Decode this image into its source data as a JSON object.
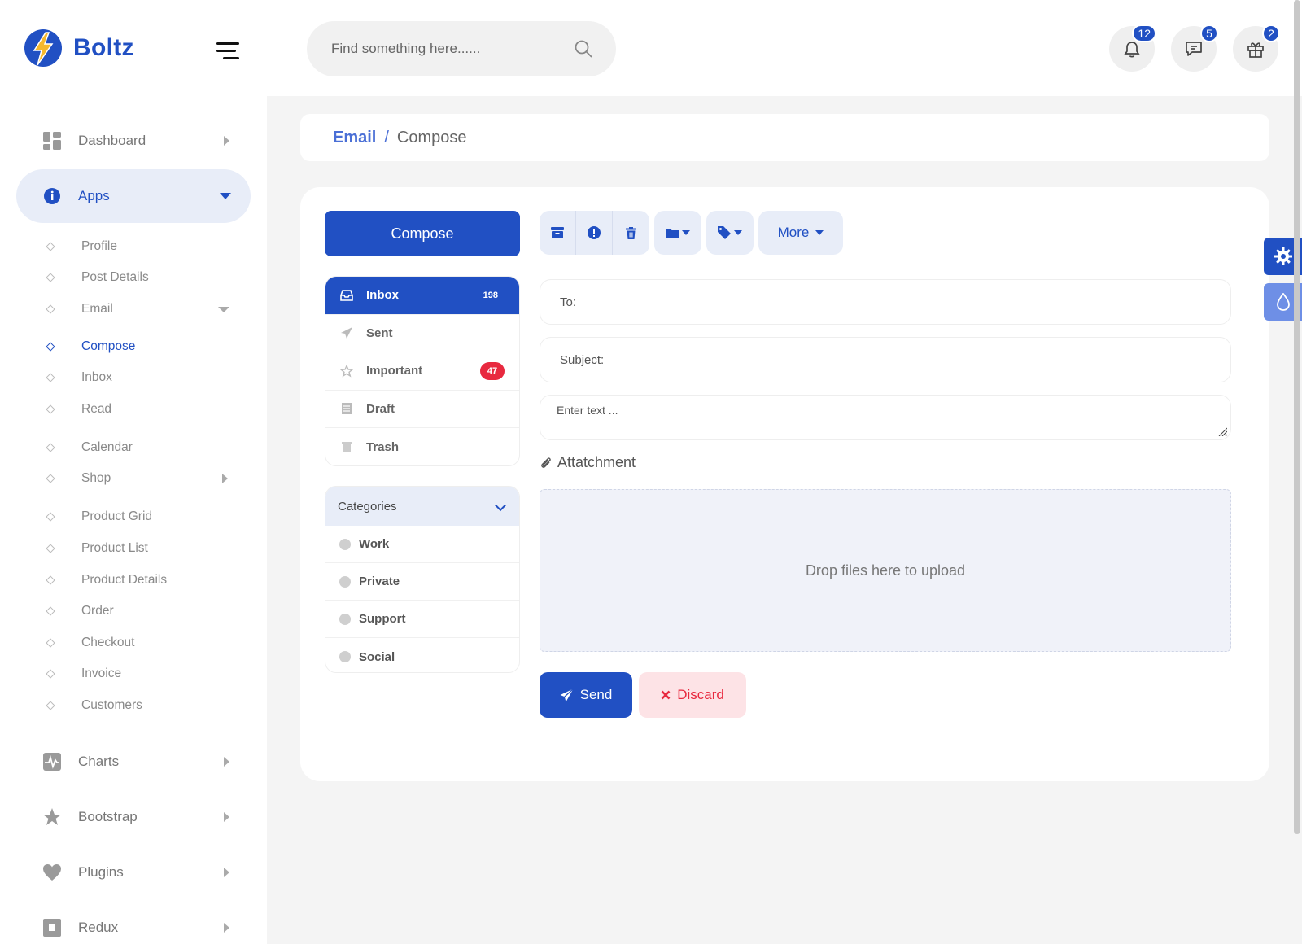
{
  "brand": {
    "name": "Boltz",
    "accent": "#2150c3"
  },
  "header": {
    "search_placeholder": "Find something here......",
    "notifications": {
      "icon": "bell-icon",
      "count": "12"
    },
    "messages": {
      "icon": "chat-icon",
      "count": "5"
    },
    "gifts": {
      "icon": "gift-icon",
      "count": "2"
    }
  },
  "sidebar": {
    "dashboard": "Dashboard",
    "apps": "Apps",
    "sub": {
      "profile": "Profile",
      "post_details": "Post Details",
      "email": "Email",
      "compose": "Compose",
      "inbox": "Inbox",
      "read": "Read",
      "calendar": "Calendar",
      "shop": "Shop",
      "product_grid": "Product Grid",
      "product_list": "Product List",
      "product_details": "Product Details",
      "order": "Order",
      "checkout": "Checkout",
      "invoice": "Invoice",
      "customers": "Customers"
    },
    "charts": "Charts",
    "bootstrap": "Bootstrap",
    "plugins": "Plugins",
    "redux": "Redux"
  },
  "breadcrumb": {
    "parent": "Email",
    "separator": "/",
    "current": "Compose"
  },
  "mail": {
    "compose_label": "Compose",
    "folders": {
      "inbox": {
        "label": "Inbox",
        "count": "198"
      },
      "sent": {
        "label": "Sent"
      },
      "important": {
        "label": "Important",
        "count": "47"
      },
      "draft": {
        "label": "Draft"
      },
      "trash": {
        "label": "Trash"
      }
    },
    "categories": {
      "title": "Categories",
      "work": "Work",
      "private": "Private",
      "support": "Support",
      "social": "Social"
    },
    "toolbar": {
      "more": "More"
    },
    "form": {
      "to_placeholder": "To:",
      "subject_placeholder": "Subject:",
      "body_placeholder": "Enter text ...",
      "attachment_label": "Attatchment",
      "dropzone_label": "Drop files here to upload",
      "send_label": "Send",
      "discard_label": "Discard"
    }
  }
}
